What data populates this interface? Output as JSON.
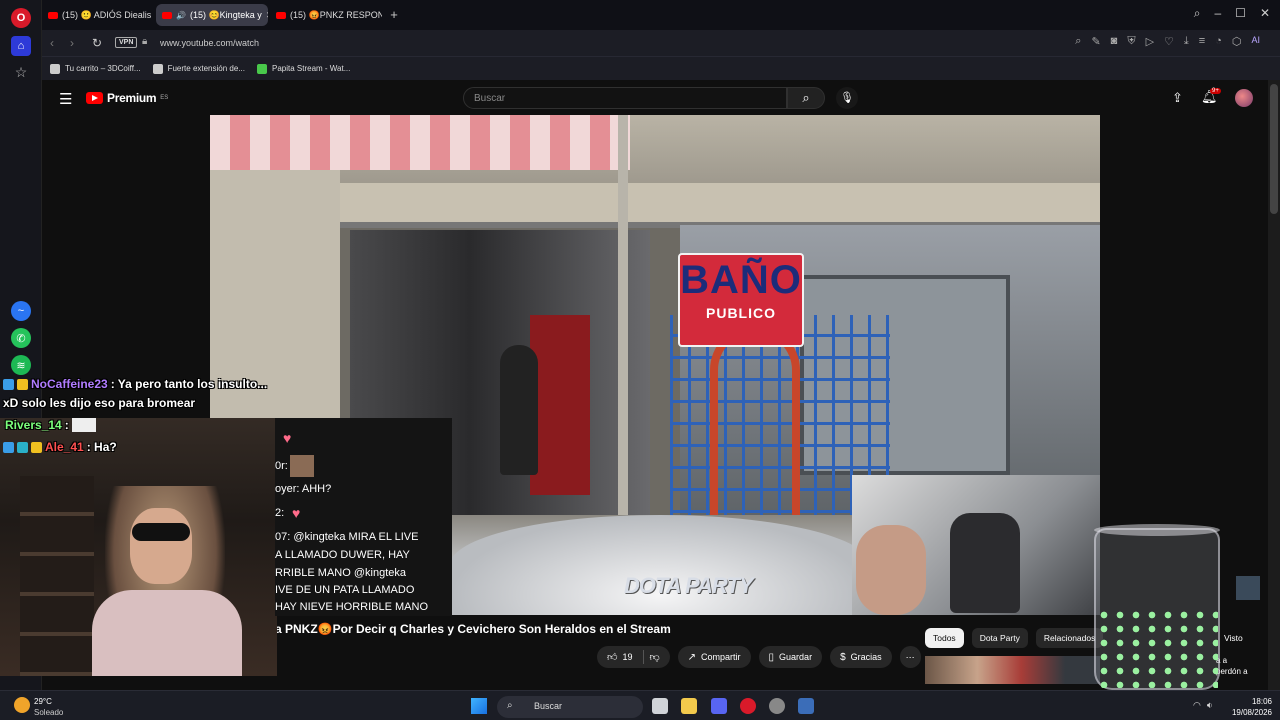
{
  "browser": {
    "tabs": [
      {
        "label": "(15) 🙂 ADIÓS Diealis ¡FE",
        "active": false
      },
      {
        "label": "(15) 😊Kingteka y",
        "active": true
      },
      {
        "label": "(15) 😡PNKZ RESPONDE",
        "active": false
      }
    ],
    "new_tab": "+",
    "vpn_label": "VPN",
    "url": "www.youtube.com/watch",
    "aria_label": "AI",
    "bookmarks": [
      {
        "label": "Tu carrito – 3DCoiff..."
      },
      {
        "label": "Fuerte extensión de..."
      },
      {
        "label": "Papita Stream - Wat..."
      }
    ]
  },
  "youtube": {
    "logo_text": "Premium",
    "logo_region": "ES",
    "search_placeholder": "Buscar",
    "notifications_badge": "9+",
    "video": {
      "sign_big": "BAÑO",
      "sign_small": "PUBLICO",
      "watermark": "DOTA PARTY"
    },
    "title": "a PNKZ😡Por Decir q Charles y Cevichero Son Heraldos en el Stream",
    "actions": {
      "likes": "19",
      "share": "Compartir",
      "save": "Guardar",
      "thanks": "Gracias",
      "more": "⋯"
    },
    "chips": [
      "Todos",
      "Dota Party",
      "Relacionados"
    ],
    "chip_visto": "Visto",
    "rec_text": "a a\nperdón a"
  },
  "stream_chat": {
    "overlay_lines": [
      {
        "user": "NoCaffeine23",
        "color": "#b07cff",
        "message": ": Ya pero tanto los insulto..."
      },
      {
        "user": "",
        "color": "#ffffff",
        "message": "xD solo les dijo eso para bromear"
      },
      {
        "user": "Rivers_14",
        "color": "#7cff7c",
        "message": ":"
      },
      {
        "user": "Ale_41",
        "color": "#ff5050",
        "message": ": Ha?"
      }
    ],
    "panel_lines": [
      "0r:",
      "oyer: AHH?",
      "2:",
      "07: @kingteka MIRA EL LIVE",
      "A LLAMADO DUWER, HAY",
      "RRIBLE MANO @kingteka",
      "IVE DE UN PATA LLAMADO",
      "HAY NIEVE HORRIBLE MANO"
    ]
  },
  "taskbar": {
    "weather_temp": "29°C",
    "weather_cond": "Soleado",
    "search_label": "Buscar",
    "time": "18:06",
    "date": "19/08/2026"
  },
  "colors": {
    "youtube_red": "#ff0000",
    "opera_red": "#d91a2a",
    "chip_active": "#f1f1f1"
  }
}
